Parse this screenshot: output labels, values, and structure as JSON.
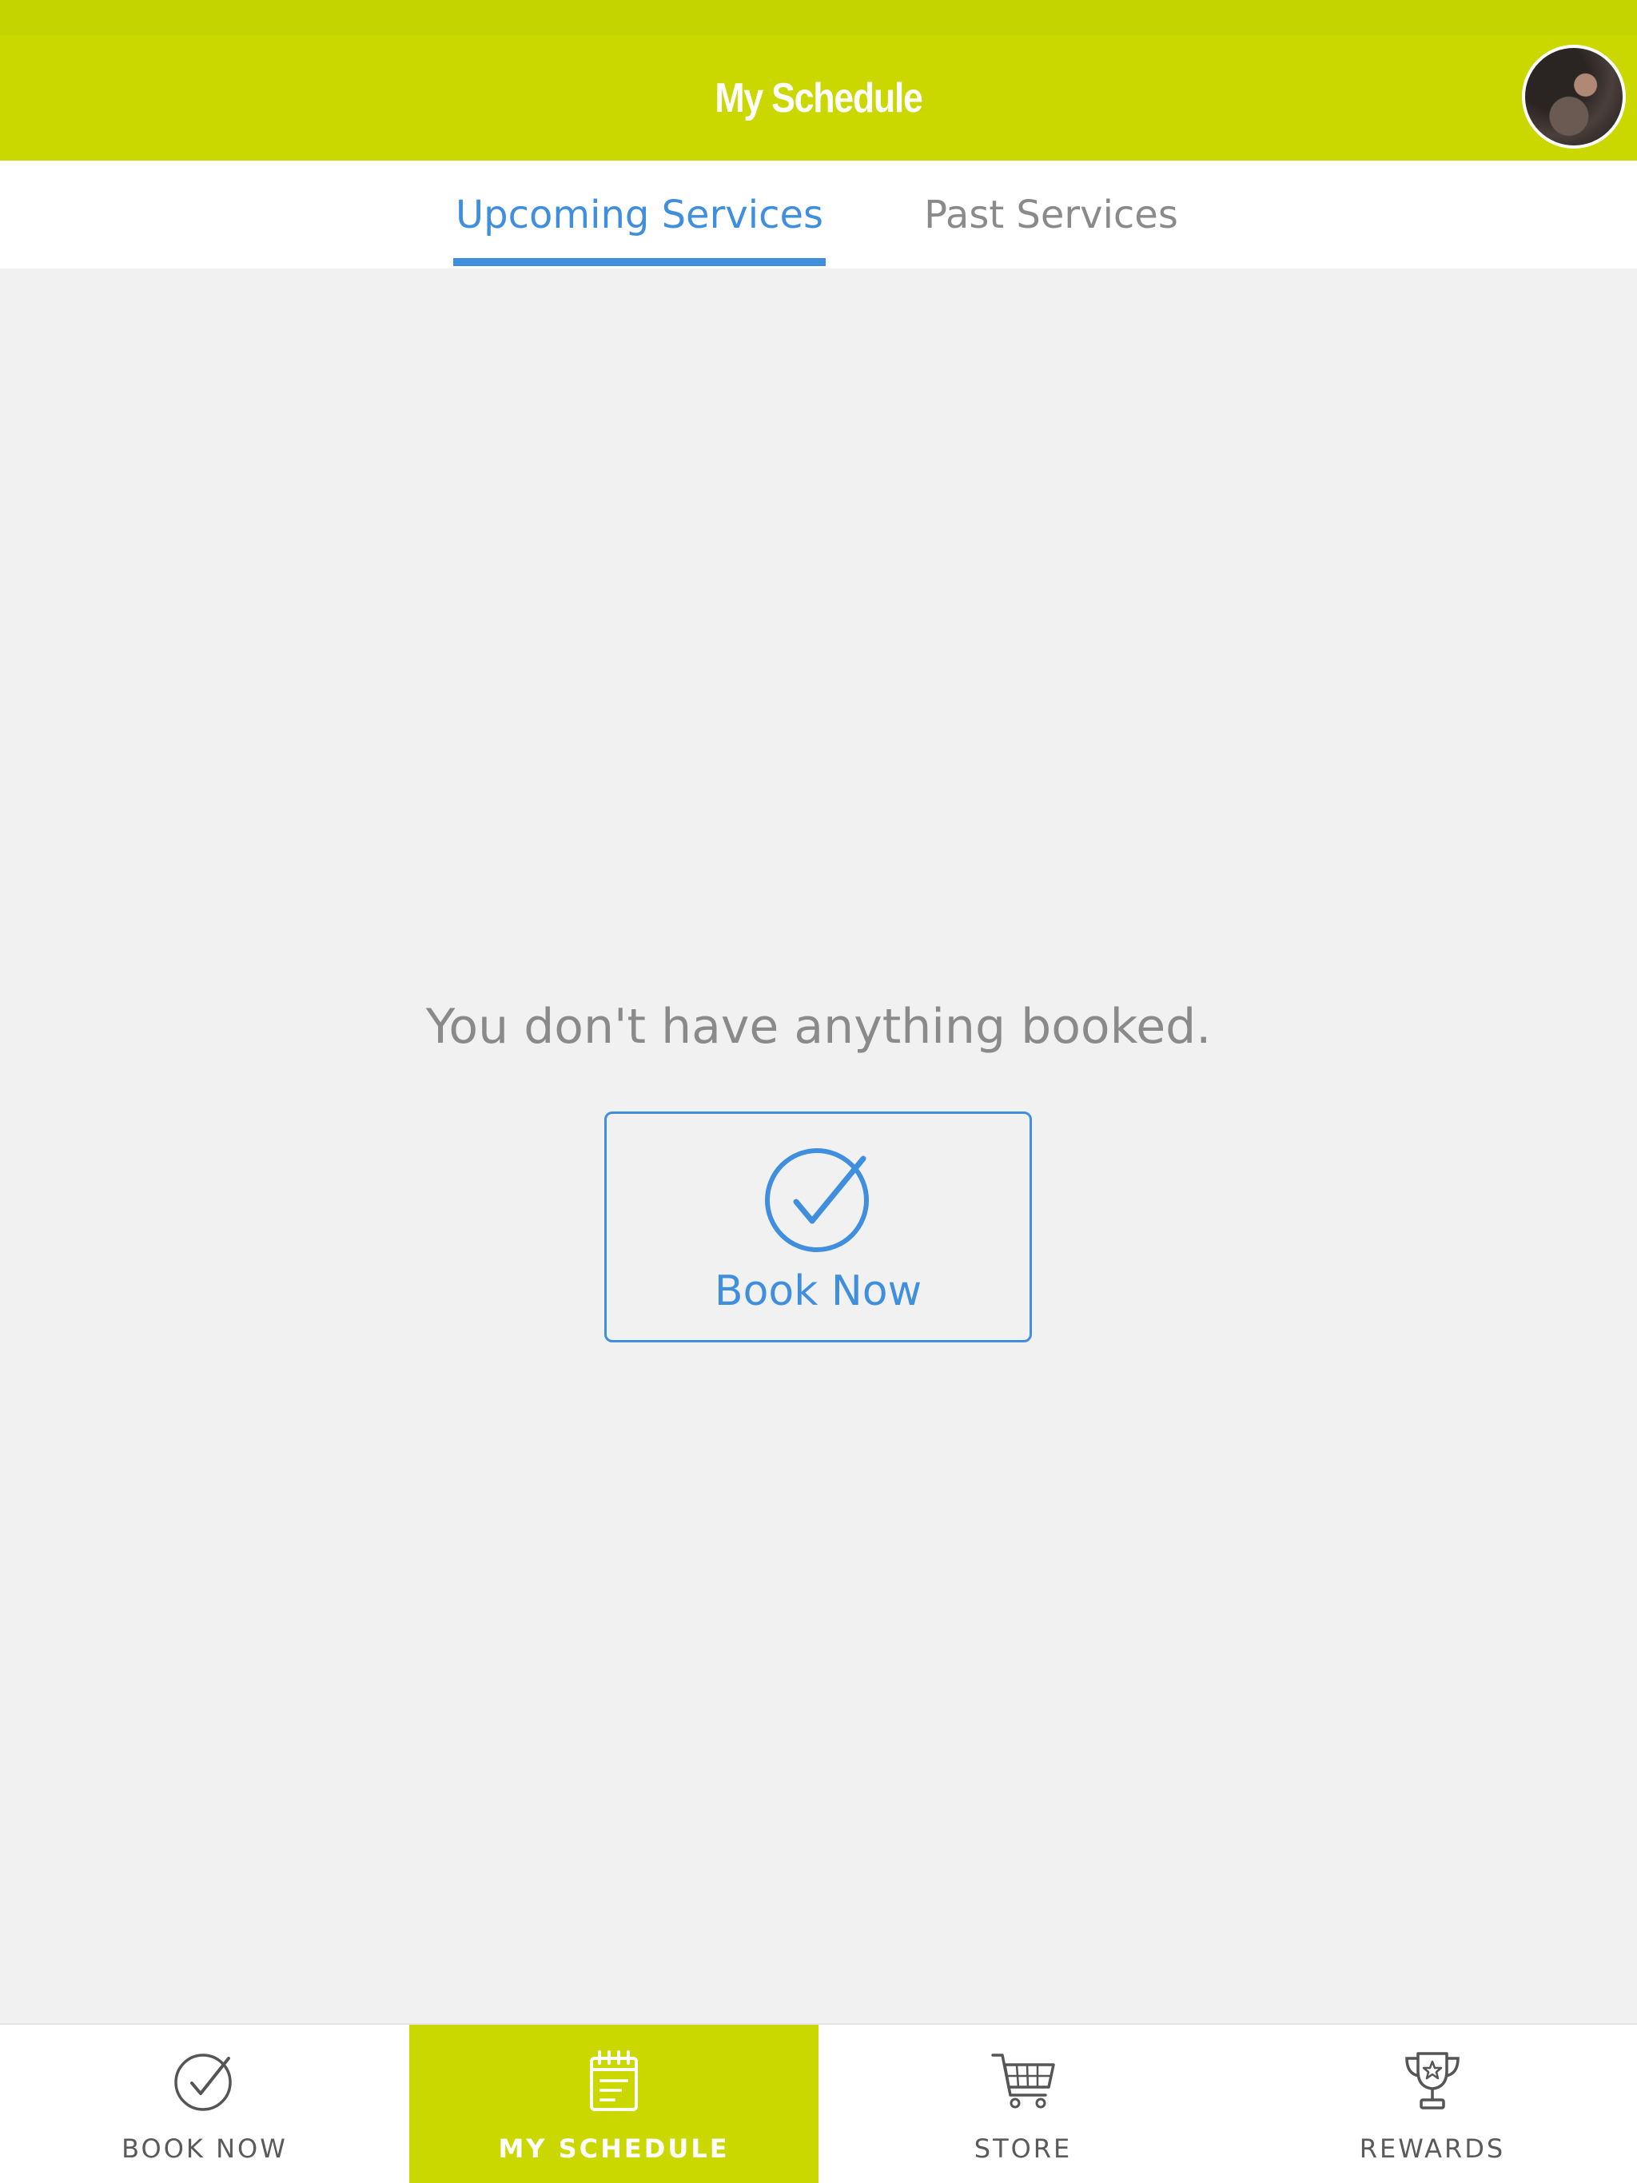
{
  "header": {
    "title": "My Schedule",
    "avatar": "user-avatar"
  },
  "tabs": [
    {
      "label": "Upcoming Services",
      "active": true
    },
    {
      "label": "Past Services",
      "active": false
    }
  ],
  "empty_state": {
    "message": "You don't have anything booked.",
    "button_label": "Book Now",
    "button_icon": "check-circle-icon"
  },
  "bottom_nav": [
    {
      "label": "BOOK NOW",
      "icon": "check-circle-icon",
      "active": false
    },
    {
      "label": "MY SCHEDULE",
      "icon": "calendar-icon",
      "active": true
    },
    {
      "label": "STORE",
      "icon": "shopping-cart-icon",
      "active": false
    },
    {
      "label": "REWARDS",
      "icon": "trophy-icon",
      "active": false
    }
  ],
  "colors": {
    "brand": "#cad800",
    "accent": "#3f8fde",
    "background": "#f1f1f1",
    "muted_text": "#8a8a8a"
  }
}
